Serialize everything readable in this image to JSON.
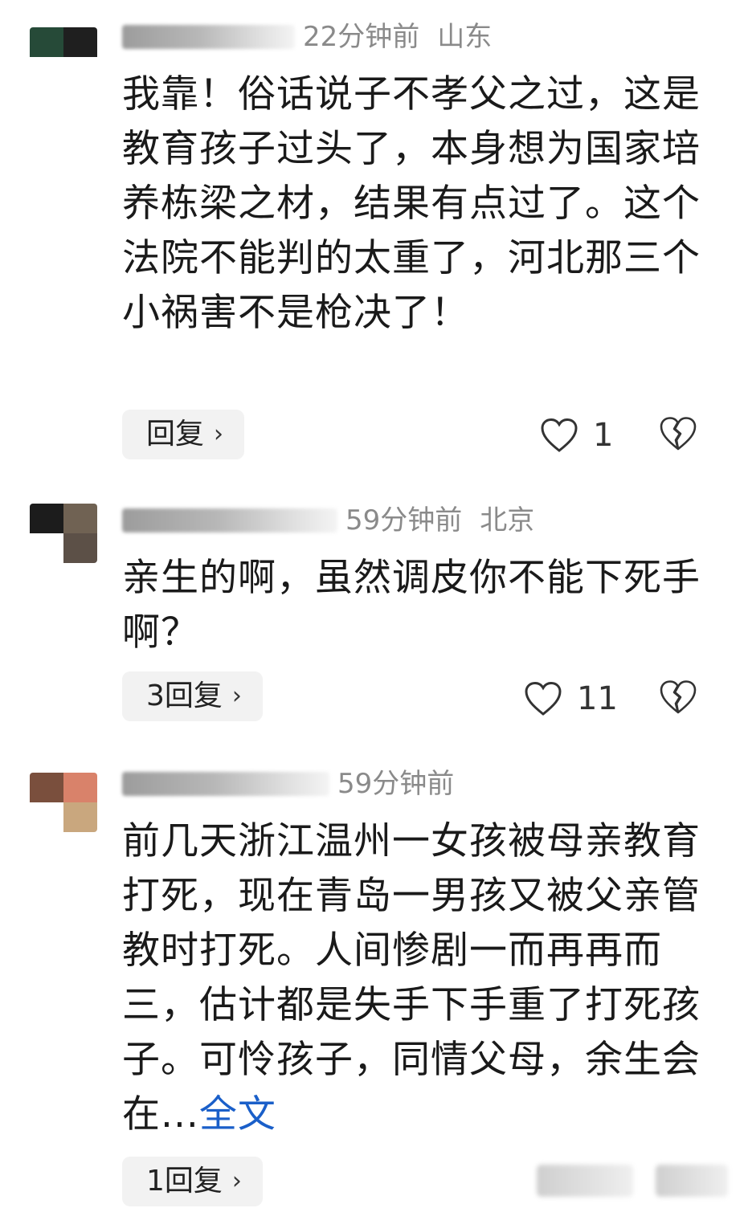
{
  "comments": [
    {
      "time": "22分钟前",
      "location": "山东",
      "text": "我靠！俗话说子不孝父之过，这是教育孩子过头了，本身想为国家培养栋梁之材，结果有点过了。这个法院不能判的太重了，河北那三个小祸害不是枪决了！",
      "reply_label": "回复",
      "likes": "1"
    },
    {
      "time": "59分钟前",
      "location": "北京",
      "text": "亲生的啊，虽然调皮你不能下死手啊？",
      "reply_label": "3回复",
      "likes": "11"
    },
    {
      "time": "59分钟前",
      "location": "",
      "text": "前几天浙江温州一女孩被母亲教育打死，现在青岛一男孩又被父亲管教时打死。人间惨剧一而再再而三，估计都是失手下手重了打死孩子。可怜孩子，同情父母，余生会在...",
      "more_label": "全文",
      "reply_label": "1回复",
      "likes": ""
    }
  ],
  "icons": {
    "like": "heart-outline-icon",
    "dislike": "broken-heart-icon",
    "reply_chevron": "chevron-right-icon"
  },
  "colors": {
    "meta_text": "#8a8a8a",
    "link": "#1a5fc9",
    "reply_bg": "#f2f2f2"
  }
}
